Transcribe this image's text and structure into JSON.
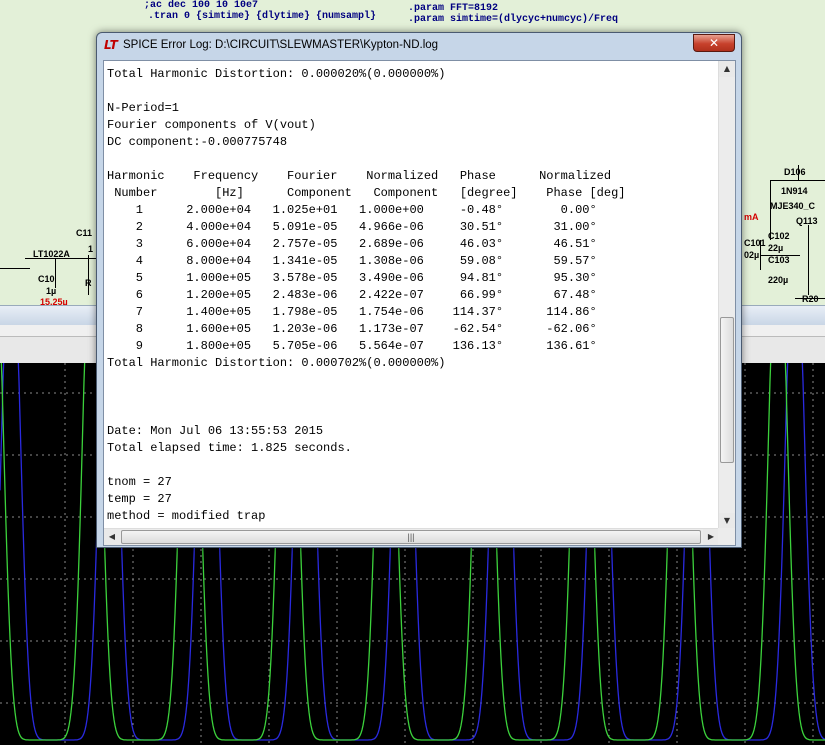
{
  "schematic": {
    "directives": [
      ";ac dec 100 10 10e7",
      ".tran 0 {simtime} {dlytime} {numsampl}",
      ".param FFT=8192",
      ".param simtime=(dlycyc+numcyc)/Freq"
    ],
    "labels": [
      "D106",
      "1N914",
      "MJE340_C",
      "Q113",
      "C102",
      "22µ",
      "C101",
      "02µ",
      "C103",
      "220µ",
      "R20",
      "C11",
      "LT1022A",
      "C10",
      "1µ",
      "R",
      "1",
      "mA",
      "15.25µ"
    ]
  },
  "dialog": {
    "title": "SPICE Error Log: D:\\CIRCUIT\\SLEWMASTER\\Kypton-ND.log",
    "close_symbol": "✕",
    "log_lines": [
      "Total Harmonic Distortion: 0.000020%(0.000000%)",
      "",
      "N-Period=1",
      "Fourier components of V(vout)",
      "DC component:-0.000775748",
      "",
      "Harmonic    Frequency    Fourier    Normalized   Phase      Normalized",
      " Number        [Hz]      Component   Component   [degree]    Phase [deg]",
      "    1      2.000e+04   1.025e+01   1.000e+00     -0.48°        0.00°",
      "    2      4.000e+04   5.091e-05   4.966e-06     30.51°       31.00°",
      "    3      6.000e+04   2.757e-05   2.689e-06     46.03°       46.51°",
      "    4      8.000e+04   1.341e-05   1.308e-06     59.08°       59.57°",
      "    5      1.000e+05   3.578e-05   3.490e-06     94.81°       95.30°",
      "    6      1.200e+05   2.483e-06   2.422e-07     66.99°       67.48°",
      "    7      1.400e+05   1.798e-05   1.754e-06    114.37°      114.86°",
      "    8      1.600e+05   1.203e-06   1.173e-07    -62.54°      -62.06°",
      "    9      1.800e+05   5.705e-06   5.564e-07    136.13°      136.61°",
      "Total Harmonic Distortion: 0.000702%(0.000000%)",
      "",
      "",
      "",
      "Date: Mon Jul 06 13:55:53 2015",
      "Total elapsed time: 1.825 seconds.",
      "",
      "tnom = 27",
      "temp = 27",
      "method = modified trap"
    ],
    "scroll": {
      "up": "▲",
      "down": "▼",
      "left": "◀",
      "right": "▶",
      "grip": "|||"
    }
  },
  "colors": {
    "trace_green": "#3cd23c",
    "trace_blue": "#2a2ae0",
    "grid": "#8a8a8a",
    "schematic_bg": "#e3f0d8"
  }
}
